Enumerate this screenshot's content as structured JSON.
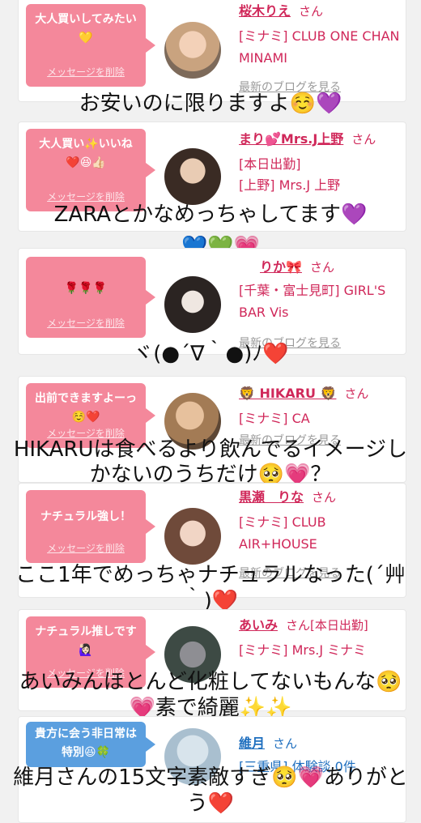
{
  "colors": {
    "accent_pink": "#f4889b",
    "name_pink": "#d0285a",
    "accent_blue": "#5b9fdf"
  },
  "cards": [
    {
      "message": "大人買いしてみたい💛",
      "delete_label": "メッセージを削除",
      "name": "桜木りえ",
      "san": "さん",
      "shop": "[ミナミ] CLUB ONE CHAN MINAMI",
      "blog": "最新のブログを見る",
      "caption": "お安いのに限りますよ☺️💜"
    },
    {
      "message": "大人買い✨いいね❤️😆👍🏻",
      "delete_label": "メッセージを削除",
      "name": "まり💕Mrs.J上野",
      "san": "さん",
      "status": "[本日出勤]",
      "shop": "[上野] Mrs.J 上野",
      "blog": "最新のブログを見る",
      "caption": "ZARAとかなめっちゃしてます💜",
      "caption2": "💙💚💗"
    },
    {
      "message": "🌹🌹🌹",
      "delete_label": "メッセージを削除",
      "name": "りか🎀",
      "san": "さん",
      "shop": "[千葉・富士見町] GIRL'S BAR Vis",
      "blog": "最新のブログを見る",
      "caption": "ヾ(●´∇｀●)ﾉ❤️"
    },
    {
      "message": "出前できますよーっ☺️❤️",
      "delete_label": "メッセージを削除",
      "name": "🦁 HIKARU 🦁",
      "san": "さん",
      "shop": "[ミナミ] CA",
      "blog": "最新のブログを見る",
      "caption": "HIKARUは食べるより飲んでるイメージしかないのうちだけ🥺💗？"
    },
    {
      "message": "ナチュラル強し！",
      "delete_label": "メッセージを削除",
      "name": "黒瀬　りな",
      "san": "さん",
      "shop": "[ミナミ] CLUB AIR+HOUSE",
      "blog": "最新のブログを見る",
      "caption": "ここ1年でめっちゃナチュラルなった(´艸｀)❤️"
    },
    {
      "message": "ナチュラル推しです🙋🏻‍♀️",
      "delete_label": "メッセージを削除",
      "name": "あいみ",
      "san": "さん",
      "status": "[本日出勤]",
      "shop": "[ミナミ] Mrs.J ミナミ",
      "blog": "最新のブログを見る",
      "caption": "あいみんほとんど化粧してないもんな🥺💗素で綺麗✨✨"
    },
    {
      "message": "貴方に会う非日常は特別😆🍀",
      "delete_label": "メッセージを削除",
      "name": "維月",
      "san": "さん",
      "shop": "[三重県] 体験談 0件",
      "caption": "維月さんの15文字素敵すぎ🥺💗ありがとう❤️"
    }
  ]
}
